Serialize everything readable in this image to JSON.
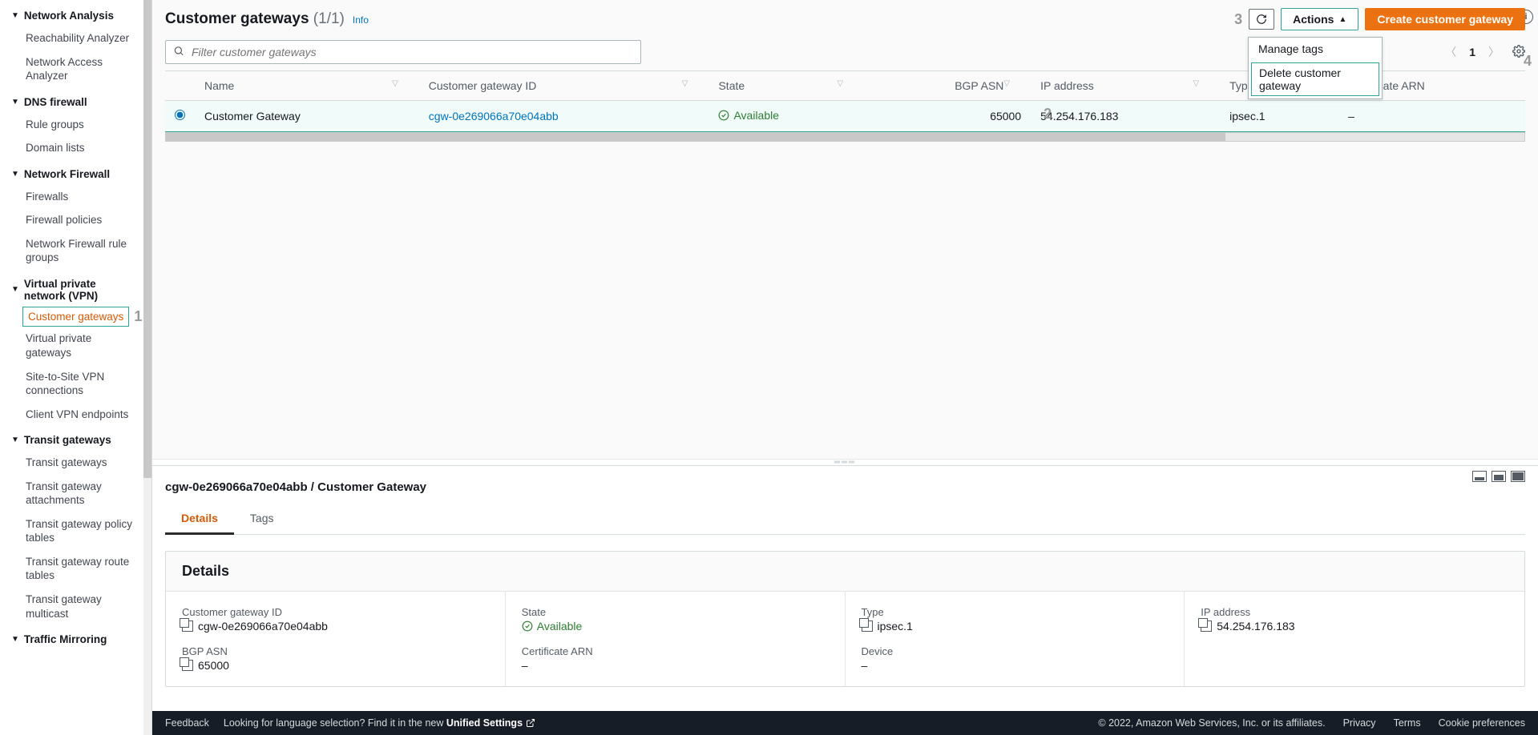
{
  "sidebar": {
    "sections": [
      {
        "title": "Network Analysis",
        "items": [
          "Reachability Analyzer",
          "Network Access Analyzer"
        ]
      },
      {
        "title": "DNS firewall",
        "items": [
          "Rule groups",
          "Domain lists"
        ]
      },
      {
        "title": "Network Firewall",
        "items": [
          "Firewalls",
          "Firewall policies",
          "Network Firewall rule groups"
        ]
      },
      {
        "title": "Virtual private network (VPN)",
        "items": [
          "Customer gateways",
          "Virtual private gateways",
          "Site-to-Site VPN connections",
          "Client VPN endpoints"
        ]
      },
      {
        "title": "Transit gateways",
        "items": [
          "Transit gateways",
          "Transit gateway attachments",
          "Transit gateway policy tables",
          "Transit gateway route tables",
          "Transit gateway multicast"
        ]
      },
      {
        "title": "Traffic Mirroring",
        "items": []
      }
    ],
    "active_step_num": "1"
  },
  "header": {
    "title": "Customer gateways",
    "count": "(1/1)",
    "info": "Info",
    "step_top": "3",
    "actions_label": "Actions",
    "create_label": "Create customer gateway",
    "actions_menu": {
      "manage": "Manage tags",
      "delete": "Delete customer gateway",
      "step": "4"
    },
    "search_placeholder": "Filter customer gateways",
    "page_number": "1"
  },
  "table": {
    "columns": [
      "Name",
      "Customer gateway ID",
      "State",
      "BGP ASN",
      "IP address",
      "Type",
      "Certificate ARN"
    ],
    "step": "2",
    "row": {
      "name": "Customer Gateway",
      "id": "cgw-0e269066a70e04abb",
      "state": "Available",
      "bgp": "65000",
      "ip": "54.254.176.183",
      "type": "ipsec.1",
      "cert": "–"
    }
  },
  "detail": {
    "breadcrumb": "cgw-0e269066a70e04abb / Customer Gateway",
    "tabs": {
      "details": "Details",
      "tags": "Tags"
    },
    "card_title": "Details",
    "labels": {
      "cgw_id": "Customer gateway ID",
      "state": "State",
      "type": "Type",
      "ip": "IP address",
      "bgp": "BGP ASN",
      "cert": "Certificate ARN",
      "device": "Device"
    },
    "values": {
      "cgw_id": "cgw-0e269066a70e04abb",
      "state": "Available",
      "type": "ipsec.1",
      "ip": "54.254.176.183",
      "bgp": "65000",
      "cert": "–",
      "device": "–"
    }
  },
  "footer": {
    "feedback": "Feedback",
    "lang_hint": "Looking for language selection? Find it in the new ",
    "unified": "Unified Settings",
    "copyright": "© 2022, Amazon Web Services, Inc. or its affiliates.",
    "privacy": "Privacy",
    "terms": "Terms",
    "cookie": "Cookie preferences"
  }
}
